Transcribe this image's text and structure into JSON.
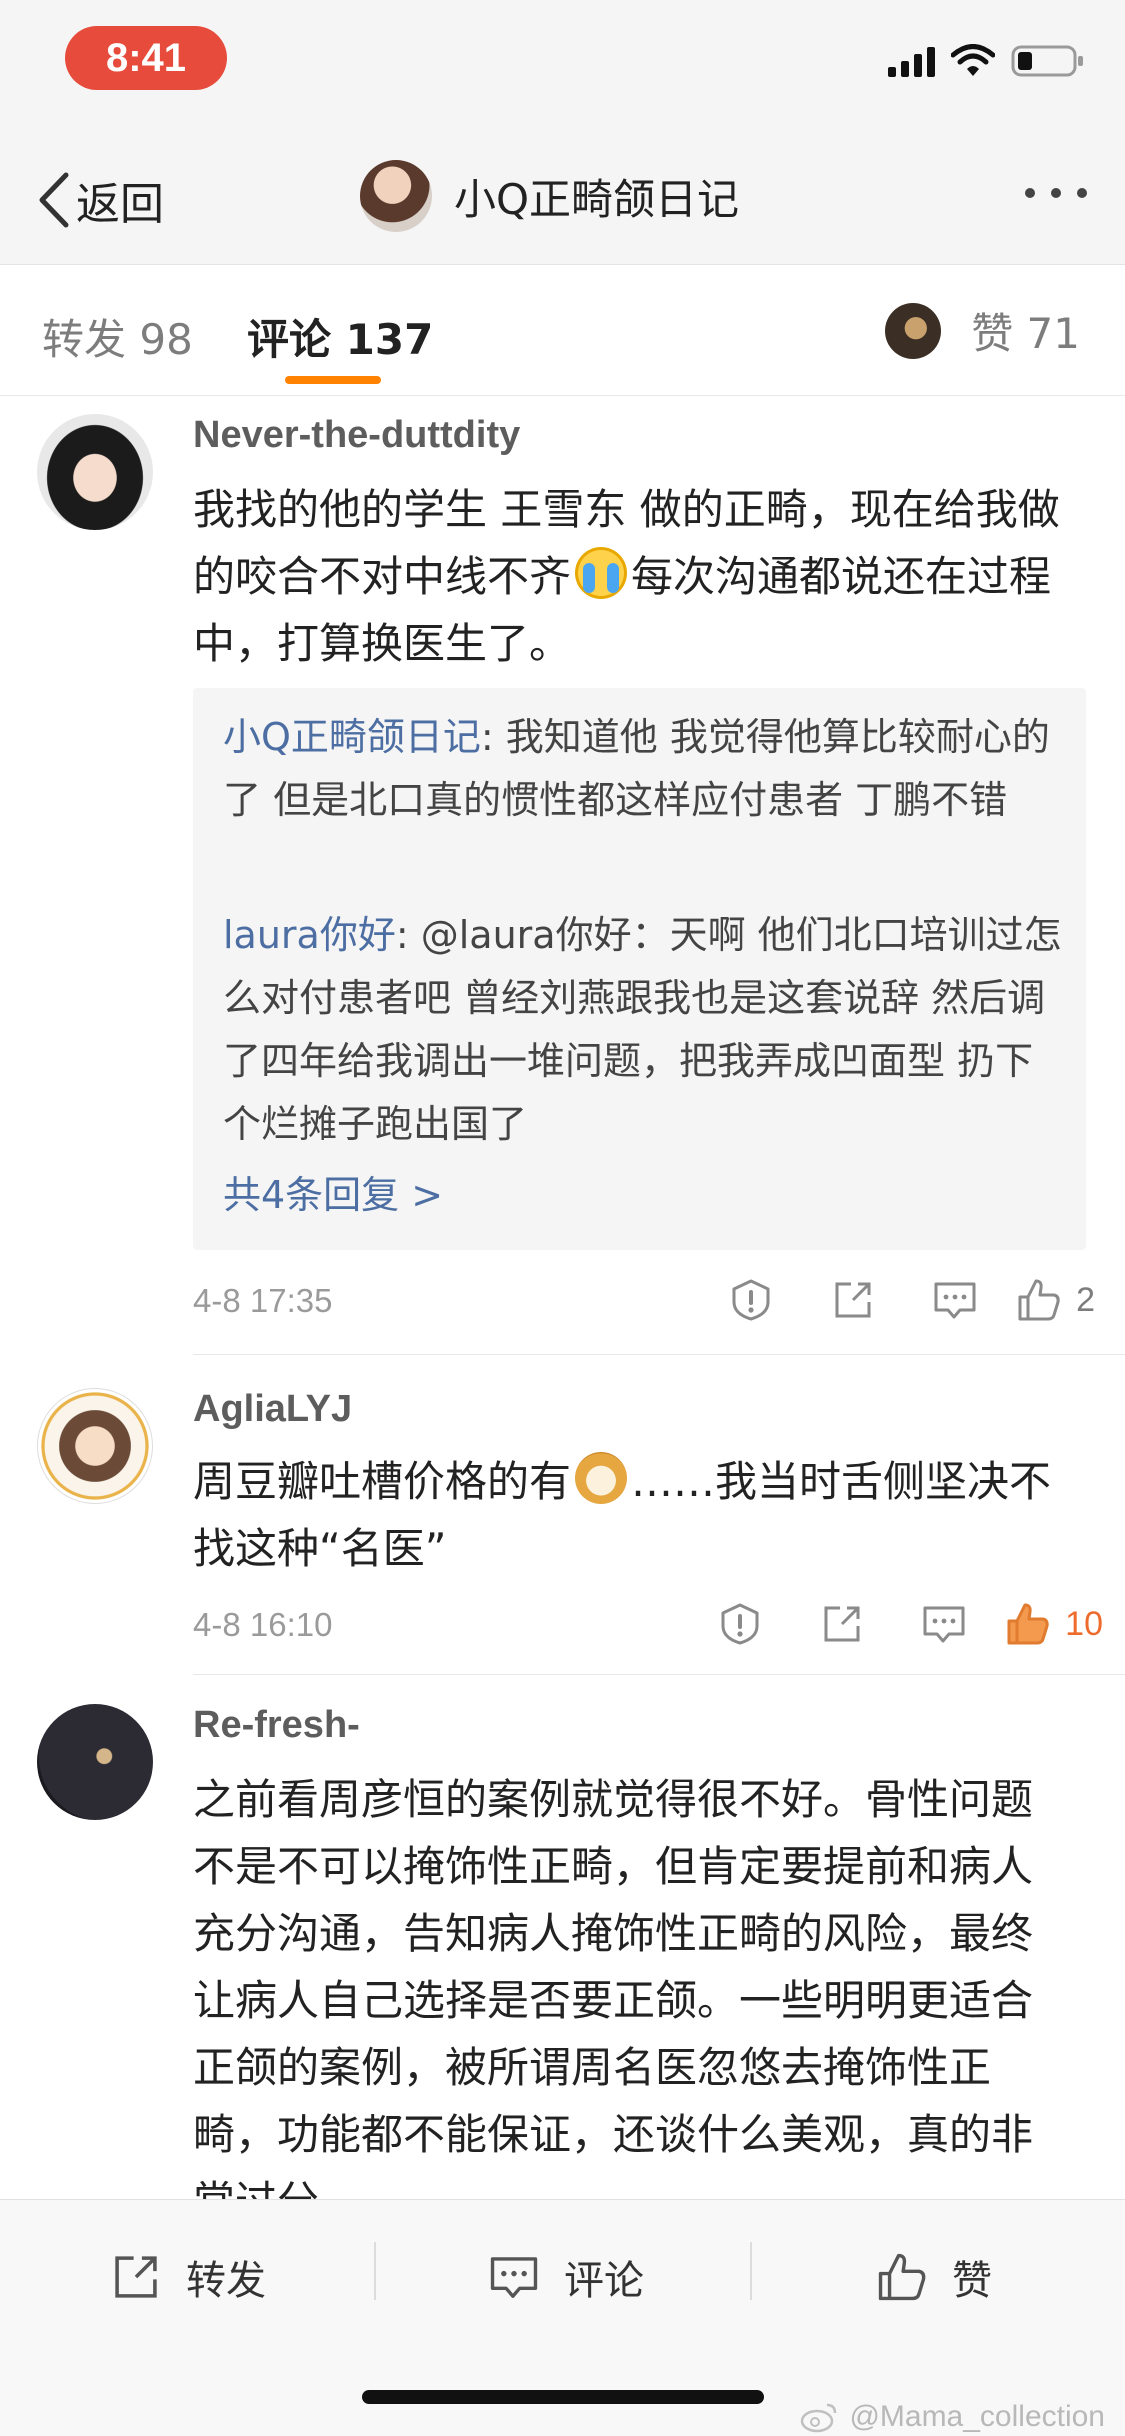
{
  "status_bar": {
    "time": "8:41"
  },
  "nav": {
    "back_label": "返回",
    "title": "小Q正畸颌日记"
  },
  "tabs": {
    "repost": "转发 98",
    "comments": "评论 137",
    "likes": "赞 71"
  },
  "comments": [
    {
      "username": "Never-the-duttdity",
      "text_before_emoji": "我找的他的学生 王雪东 做的正畸，现在给我做的咬合不对中线不齐",
      "emoji": "crying-face-emoji",
      "text_after_emoji": "每次沟通都说还在过程中，打算换医生了。",
      "replies": [
        {
          "author": "小Q正畸颌日记",
          "text": ": 我知道他 我觉得他算比较耐心的了 但是北口真的惯性都这样应付患者 丁鹏不错"
        },
        {
          "author": "laura你好",
          "text": ": @laura你好：天啊 他们北口培训过怎么对付患者吧 曾经刘燕跟我也是这套说辞 然后调了四年给我调出一堆问题，把我弄成凹面型 扔下个烂摊子跑出国了"
        }
      ],
      "more_replies": "共4条回复 >",
      "time": "4-8 17:35",
      "like_count": "2"
    },
    {
      "username": "AgliaLYJ",
      "text_before_emoji": "周豆瓣吐槽价格的有",
      "emoji": "doge-emoji",
      "text_after_emoji": "……我当时舌侧坚决不找这种“名医”",
      "time": "4-8 16:10",
      "like_count": "10",
      "liked": true,
      "like_color": "#ee6b2e"
    },
    {
      "username": "Re-fresh-",
      "text": "之前看周彦恒的案例就觉得很不好。骨性问题不是不可以掩饰性正畸，但肯定要提前和病人充分沟通，告知病人掩饰性正畸的风险，最终让病人自己选择是否要正颌。一些明明更适合正颌的案例，被所谓周名医忽悠去掩饰性正畸，功能都不能保证，还谈什么美观，真的非常过分"
    }
  ],
  "toolbar": {
    "repost": "转发",
    "comment": "评论",
    "like": "赞"
  },
  "watermark": "@Mama_collection",
  "colors": {
    "accent": "#ff8200",
    "link": "#4d6ea3",
    "liked": "#ee6b2e",
    "time_pill": "#e64b3c"
  }
}
